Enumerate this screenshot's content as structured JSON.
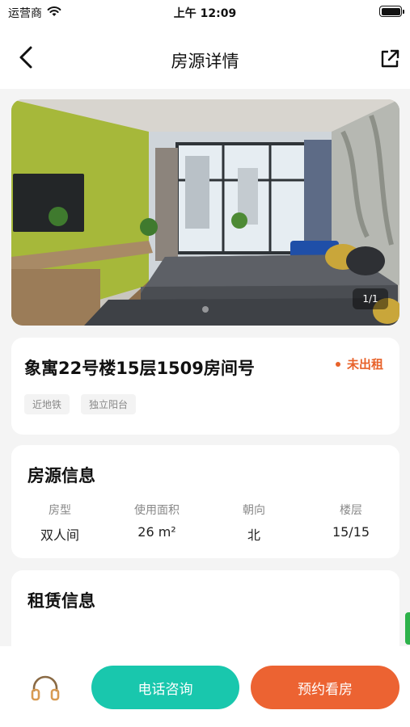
{
  "status_bar": {
    "carrier": "运营商",
    "time": "上午 12:09"
  },
  "nav": {
    "title": "房源详情",
    "back_icon": "chevron-left-icon",
    "share_icon": "share-icon"
  },
  "gallery": {
    "counter": "1/1"
  },
  "listing": {
    "title": "象寓22号楼15层1509房间号",
    "status": "未出租",
    "status_color": "#e8622a",
    "tags": [
      "近地铁",
      "独立阳台"
    ]
  },
  "property_info": {
    "title": "房源信息",
    "items": [
      {
        "label": "房型",
        "value": "双人间"
      },
      {
        "label": "使用面积",
        "value": "26 m²"
      },
      {
        "label": "朝向",
        "value": "北"
      },
      {
        "label": "楼层",
        "value": "15/15"
      }
    ]
  },
  "lease_info": {
    "title": "租赁信息"
  },
  "actions": {
    "call_label": "电话咨询",
    "book_label": "预约看房",
    "call_color": "#19c7ad",
    "book_color": "#ec6332",
    "service_icon": "headset-icon"
  }
}
